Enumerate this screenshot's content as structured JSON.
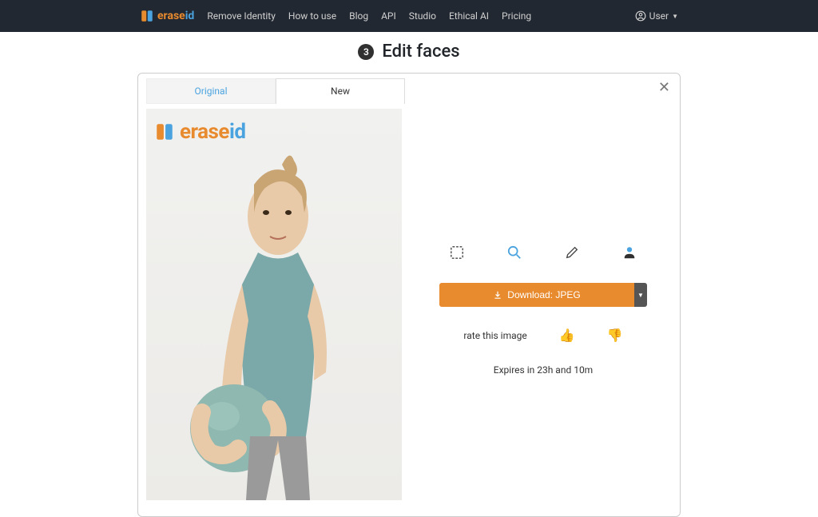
{
  "brand": {
    "erase": "erase",
    "id": "id"
  },
  "nav": {
    "links": [
      "Remove Identity",
      "How to use",
      "Blog",
      "API",
      "Studio",
      "Ethical AI",
      "Pricing"
    ],
    "user": "User"
  },
  "step": {
    "number": "3",
    "title": "Edit faces"
  },
  "tabs": {
    "original": "Original",
    "new": "New"
  },
  "tools": {
    "select": "select-icon",
    "zoom": "zoom-icon",
    "edit": "pencil-icon",
    "person": "person-icon"
  },
  "download": {
    "label": "Download: JPEG"
  },
  "rate": {
    "label": "rate this image"
  },
  "expires": "Expires in 23h and 10m",
  "colors": {
    "accent_orange": "#e88a2e",
    "accent_blue": "#4aa3df",
    "nav_bg": "#222831"
  }
}
